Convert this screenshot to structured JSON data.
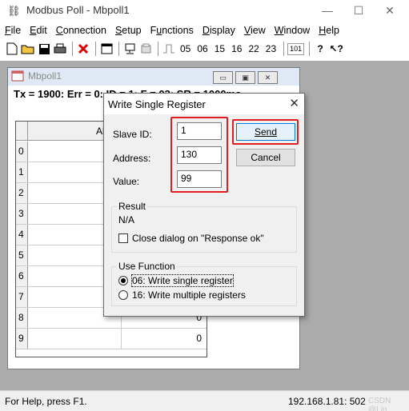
{
  "app": {
    "title": "Modbus Poll - Mbpoll1",
    "minimize_glyph": "—",
    "maximize_glyph": "☐",
    "close_glyph": "✕"
  },
  "menu": [
    "File",
    "Edit",
    "Connection",
    "Setup",
    "Functions",
    "Display",
    "View",
    "Window",
    "Help"
  ],
  "toolbar": {
    "icons": [
      "new-file-icon",
      "open-folder-icon",
      "save-icon",
      "print-icon",
      "delete-icon",
      "window-icon",
      "connect-icon",
      "disconnect-icon",
      "pulse-icon"
    ],
    "function_codes": [
      "05",
      "06",
      "15",
      "16",
      "22",
      "23"
    ],
    "btn_101": "101",
    "help_icon": "help-icon",
    "context_help_icon": "context-help-icon"
  },
  "child_window": {
    "title": "Mbpoll1",
    "status_text": "Tx = 1900: Err = 0: ID = 1: F = 03: SR = 1000ms",
    "grid": {
      "column_header": "Alias",
      "rows": [
        {
          "index": "0",
          "value": ""
        },
        {
          "index": "1",
          "value": ""
        },
        {
          "index": "2",
          "value": ""
        },
        {
          "index": "3",
          "value": ""
        },
        {
          "index": "4",
          "value": ""
        },
        {
          "index": "5",
          "value": ""
        },
        {
          "index": "6",
          "value": ""
        },
        {
          "index": "7",
          "value": ""
        },
        {
          "index": "8",
          "value": "0"
        },
        {
          "index": "9",
          "value": "0"
        }
      ]
    }
  },
  "dialog": {
    "title": "Write Single Register",
    "close_glyph": "✕",
    "slave_id_label": "Slave ID:",
    "slave_id_value": "1",
    "address_label": "Address:",
    "address_value": "130",
    "value_label": "Value:",
    "value_value": "99",
    "send_button": "Send",
    "cancel_button": "Cancel",
    "result_legend": "Result",
    "result_text": "N/A",
    "close_on_response_label": "Close dialog on \"Response ok\"",
    "close_on_response_checked": false,
    "use_function_legend": "Use Function",
    "function_options": [
      "06: Write single register",
      "16: Write multiple registers"
    ],
    "selected_function": 0,
    "highlight_color": "#e02020"
  },
  "statusbar": {
    "help_text": "For Help, press F1.",
    "connection": "192.168.1.81: 502",
    "watermark": "CSDN @Lin"
  }
}
